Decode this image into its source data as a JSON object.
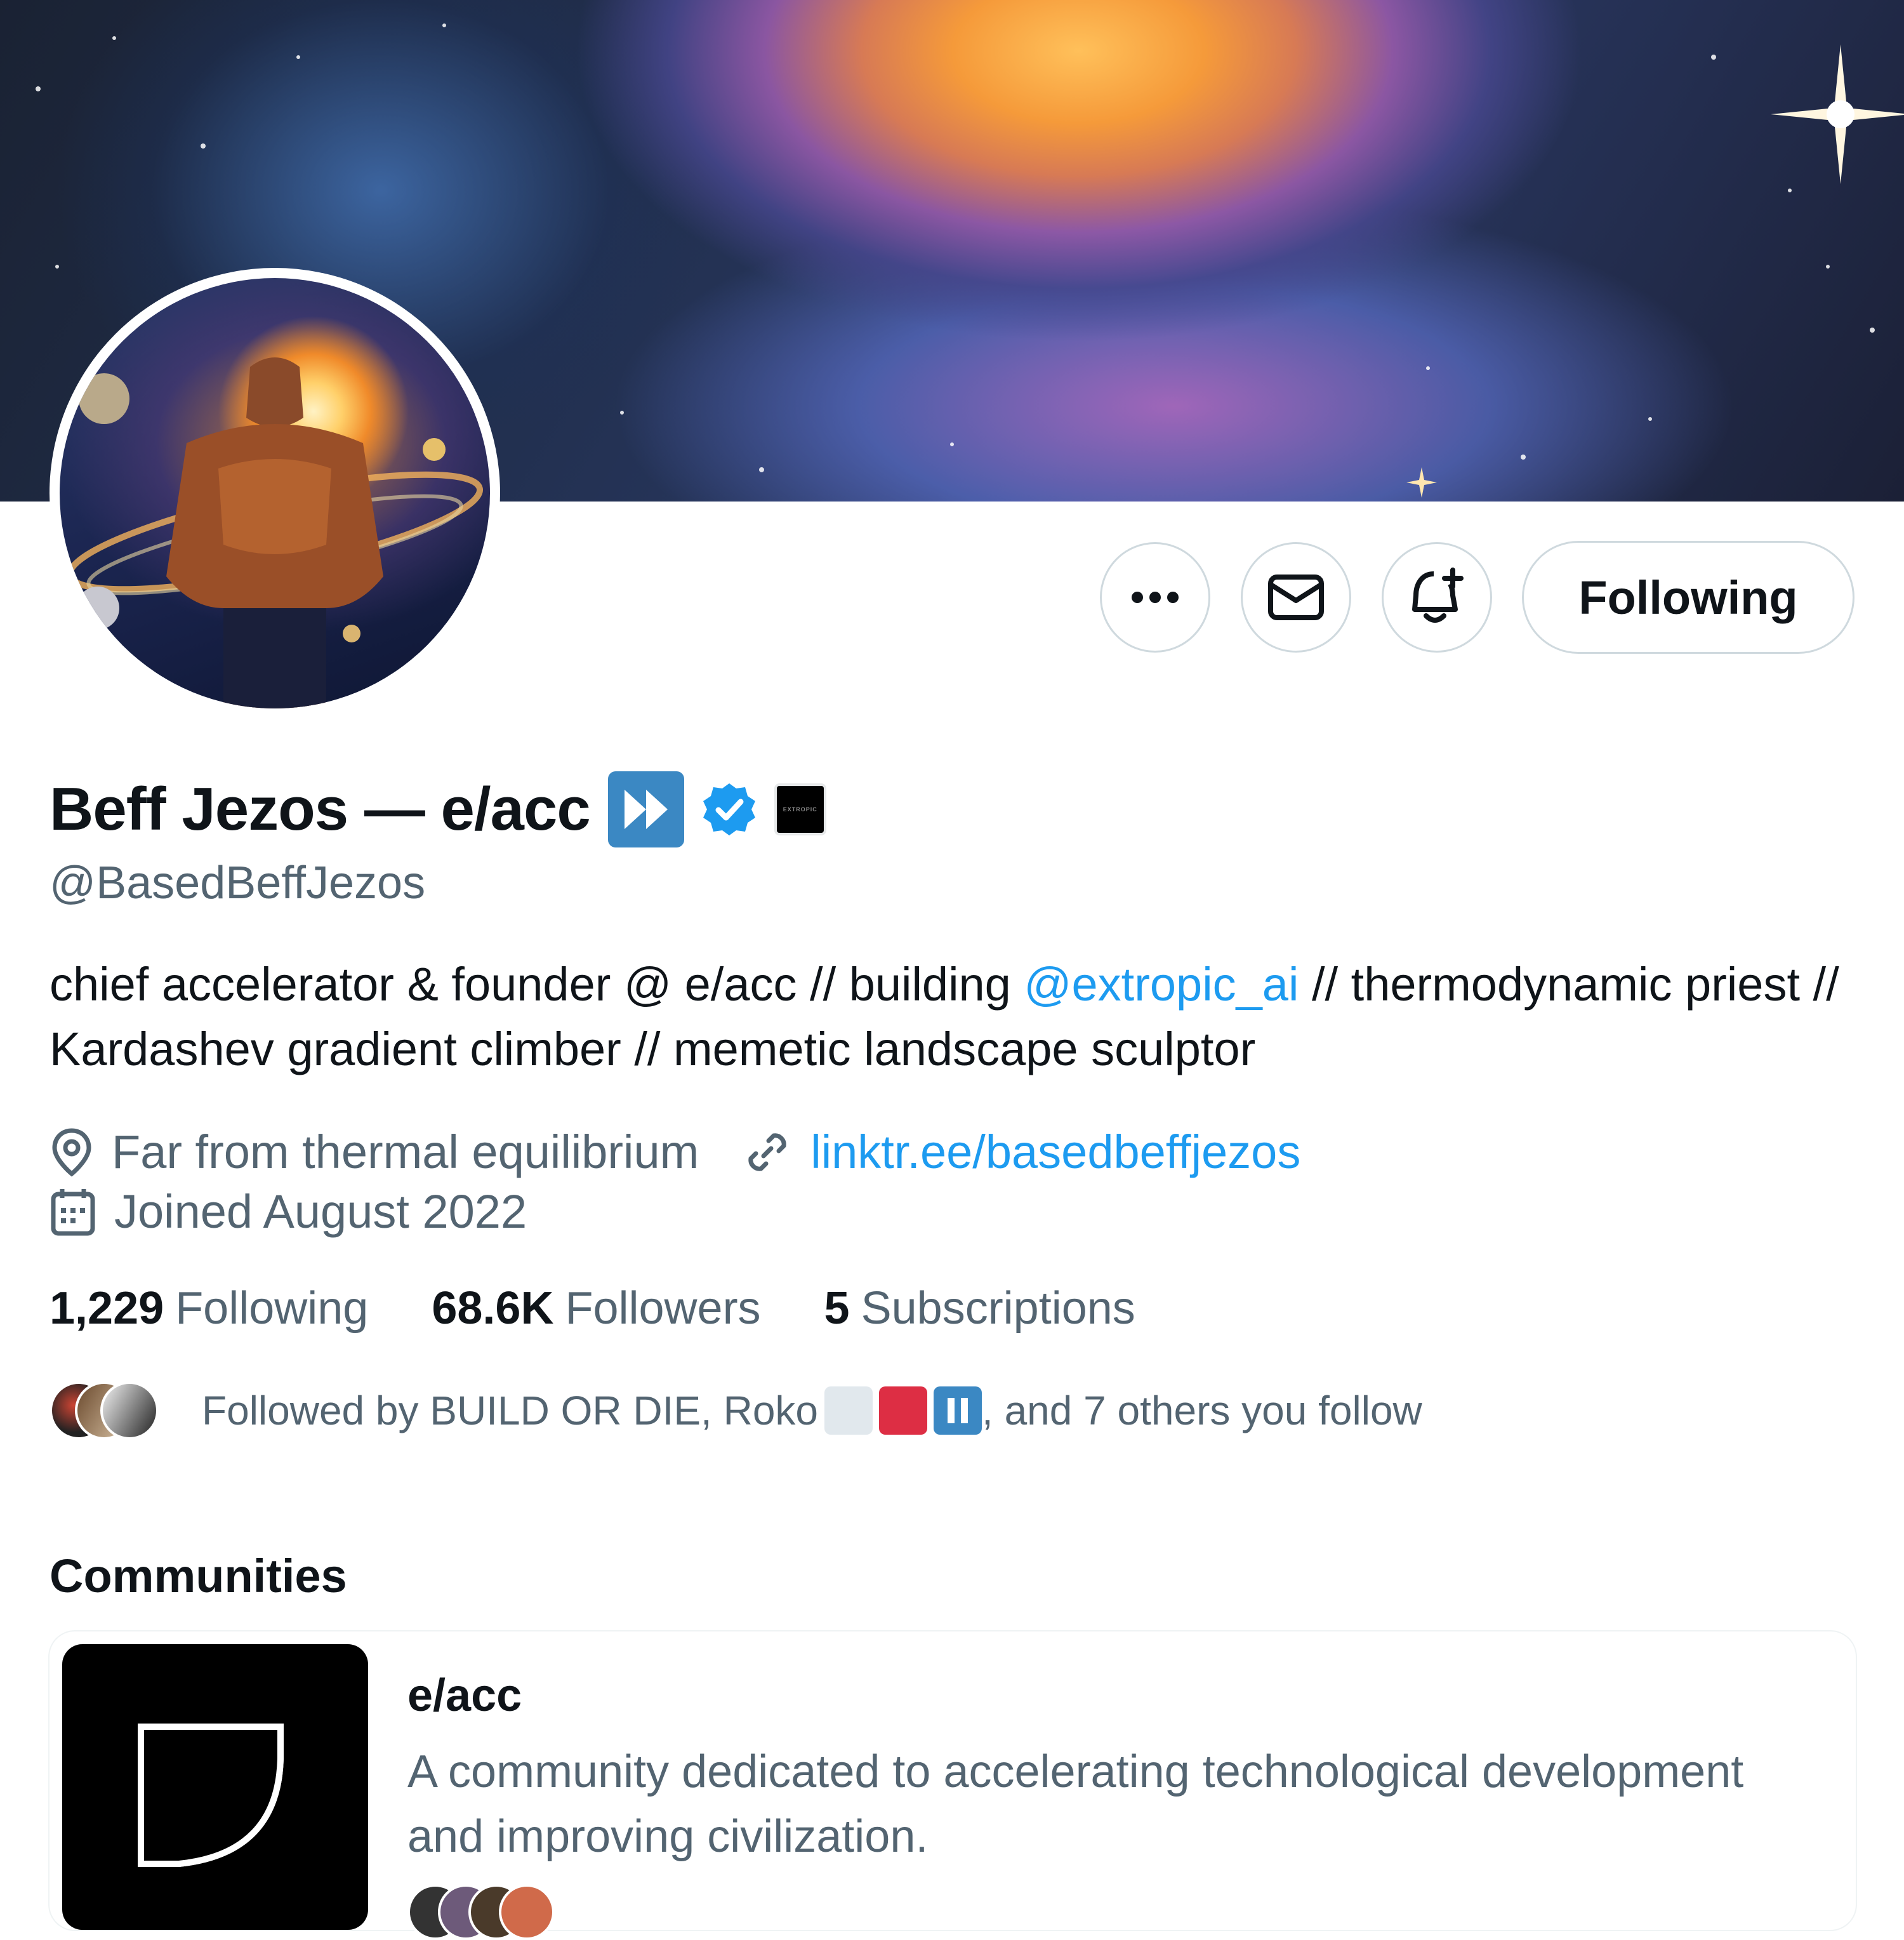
{
  "profile": {
    "name": "Beff Jezos — e/acc",
    "handle": "@BasedBeffJezos",
    "affiliate_badge_text": "EXTROPIC",
    "bio_parts": {
      "before": "chief accelerator & founder @ e/acc // building ",
      "mention": "@extropic_ai",
      "after": " // thermodynamic priest // Kardashev gradient climber // memetic landscape sculptor"
    },
    "location": "Far from thermal equilibrium",
    "website": "linktr.ee/basedbeffjezos",
    "joined": "Joined August 2022"
  },
  "actions": {
    "following_label": "Following"
  },
  "stats": {
    "following_count": "1,229",
    "following_label": "Following",
    "followers_count": "68.6K",
    "followers_label": "Followers",
    "subscriptions_count": "5",
    "subscriptions_label": "Subscriptions"
  },
  "followed_by": {
    "prefix": "Followed by BUILD OR DIE, Roko ",
    "suffix": ", and 7 others you follow"
  },
  "communities": {
    "title": "Communities",
    "items": [
      {
        "name": "e/acc",
        "description": "A community dedicated to accelerating technological development and improving civilization."
      }
    ]
  },
  "icons": {
    "more": "more-icon",
    "message": "envelope-icon",
    "notify": "bell-plus-icon",
    "verified": "verified-badge-icon",
    "location": "location-pin-icon",
    "link": "link-icon",
    "calendar": "calendar-icon"
  },
  "colors": {
    "accent": "#1d9bf0",
    "secondary_text": "#536471",
    "primary_text": "#0f1419",
    "border": "#cfd9de",
    "ff_badge": "#3b88c3"
  }
}
